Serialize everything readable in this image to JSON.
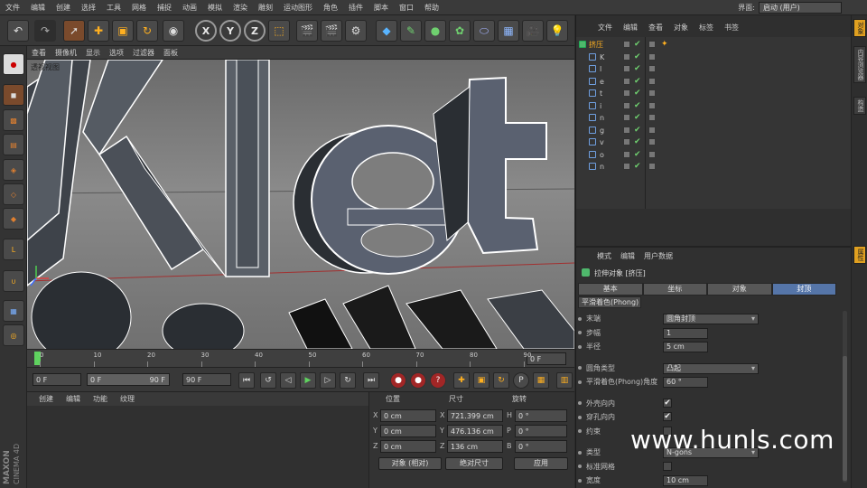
{
  "menu": [
    "文件",
    "编辑",
    "创建",
    "选择",
    "工具",
    "网格",
    "捕捉",
    "动画",
    "模拟",
    "渲染",
    "雕刻",
    "运动图形",
    "角色",
    "插件",
    "脚本",
    "窗口",
    "帮助"
  ],
  "layout": {
    "label": "界面:",
    "value": "启动 (用户)"
  },
  "toolbar": {
    "x_label": "X",
    "y_label": "Y",
    "z_label": "Z"
  },
  "viewport": {
    "menu": [
      "查看",
      "摄像机",
      "显示",
      "选项",
      "过滤器",
      "面板"
    ],
    "label": "透视视图"
  },
  "timeline": {
    "ticks": [
      "0",
      "10",
      "20",
      "30",
      "40",
      "50",
      "60",
      "70",
      "80",
      "90"
    ],
    "end_frame": "0 F"
  },
  "playback": {
    "current": "0 F",
    "start": "0 F",
    "end_inner": "90 F",
    "end": "90 F"
  },
  "materials": {
    "menu": [
      "创建",
      "编辑",
      "功能",
      "纹理"
    ]
  },
  "brand": {
    "line1": "MAXON",
    "line2": "CINEMA 4D"
  },
  "coords": {
    "headers": [
      "位置",
      "尺寸",
      "旋转"
    ],
    "rows": [
      {
        "axis": "X",
        "pos": "0 cm",
        "size_axis": "X",
        "size": "721.399 cm",
        "rot_axis": "H",
        "rot": "0 °"
      },
      {
        "axis": "Y",
        "pos": "0 cm",
        "size_axis": "Y",
        "size": "476.136 cm",
        "rot_axis": "P",
        "rot": "0 °"
      },
      {
        "axis": "Z",
        "pos": "0 cm",
        "size_axis": "Z",
        "size": "136 cm",
        "rot_axis": "B",
        "rot": "0 °"
      }
    ],
    "mode": "对象 (相对)",
    "size_mode": "绝对尺寸",
    "apply": "应用"
  },
  "objects": {
    "menu": [
      "文件",
      "编辑",
      "查看",
      "对象",
      "标签",
      "书签"
    ],
    "items": [
      "挤压",
      "K",
      "l",
      "e",
      "t",
      "i",
      "n",
      "g",
      "v",
      "o",
      "n"
    ]
  },
  "attributes": {
    "menu": [
      "模式",
      "编辑",
      "用户数据"
    ],
    "title": "拉伸对象 [挤压]",
    "tabs": [
      "基本",
      "坐标",
      "对象",
      "封顶"
    ],
    "active_tab": 3,
    "subtab": "平滑着色(Phong)",
    "rows": [
      {
        "label": "末端",
        "value": "圆角封顶",
        "type": "drop",
        "w": 106
      },
      {
        "label": "步幅",
        "value": "1",
        "type": "field",
        "w": 50
      },
      {
        "label": "半径",
        "value": "5 cm",
        "type": "field",
        "w": 50
      },
      {
        "label": "",
        "value": "",
        "type": "gap",
        "w": 0
      },
      {
        "label": "圆角类型",
        "value": "凸起",
        "type": "drop",
        "w": 106
      },
      {
        "label": "平滑着色(Phong)角度",
        "value": "60 °",
        "type": "field",
        "w": 50
      },
      {
        "label": "",
        "value": "",
        "type": "gap",
        "w": 0
      },
      {
        "label": "外壳向内",
        "value": "✔",
        "type": "check",
        "w": 0
      },
      {
        "label": "穿孔向内",
        "value": "✔",
        "type": "check",
        "w": 0
      },
      {
        "label": "约束",
        "value": "",
        "type": "check",
        "w": 0
      },
      {
        "label": "",
        "value": "",
        "type": "gap",
        "w": 0
      },
      {
        "label": "类型",
        "value": "N-gons",
        "type": "drop",
        "w": 106
      },
      {
        "label": "标准网格",
        "value": "",
        "type": "check",
        "w": 0
      },
      {
        "label": "宽度",
        "value": "10 cm",
        "type": "field",
        "w": 50
      }
    ]
  },
  "side_tabs": [
    "对象",
    "内容浏览器",
    "构造"
  ],
  "side_tab_attr": "属性",
  "watermark": "www.hunls.com"
}
